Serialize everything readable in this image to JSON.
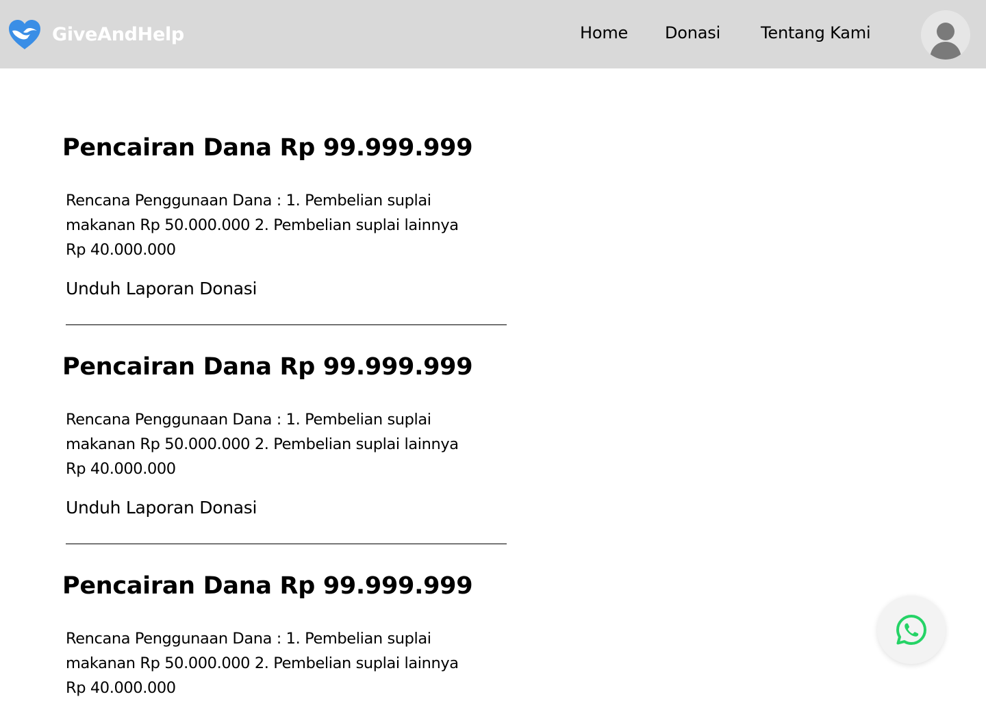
{
  "header": {
    "brand_name": "GiveAndHelp",
    "nav": {
      "home": "Home",
      "donasi": "Donasi",
      "tentang": "Tentang Kami"
    }
  },
  "disbursements": [
    {
      "title": "Pencairan Dana Rp 99.999.999",
      "description_lines": [
        "Rencana Penggunaan Dana : 1. Pembelian suplai",
        "makanan Rp 50.000.000 2. Pembelian suplai lainnya",
        "Rp 40.000.000"
      ],
      "download_label": "Unduh Laporan Donasi"
    },
    {
      "title": "Pencairan Dana Rp 99.999.999",
      "description_lines": [
        "Rencana Penggunaan Dana : 1. Pembelian suplai",
        "makanan Rp 50.000.000 2. Pembelian suplai lainnya",
        "Rp 40.000.000"
      ],
      "download_label": "Unduh Laporan Donasi"
    },
    {
      "title": "Pencairan Dana Rp 99.999.999",
      "description_lines": [
        "Rencana Penggunaan Dana : 1. Pembelian suplai",
        "makanan Rp 50.000.000 2. Pembelian suplai lainnya",
        "Rp 40.000.000"
      ]
    }
  ],
  "icons": {
    "logo": "heart-hands-icon",
    "avatar": "user-avatar-icon",
    "whatsapp": "whatsapp-icon"
  },
  "colors": {
    "header_bg": "#d9d9d9",
    "brand_blue": "#3a8ee6",
    "whatsapp_green": "#25d366",
    "avatar_gray": "#7a7a7a"
  }
}
